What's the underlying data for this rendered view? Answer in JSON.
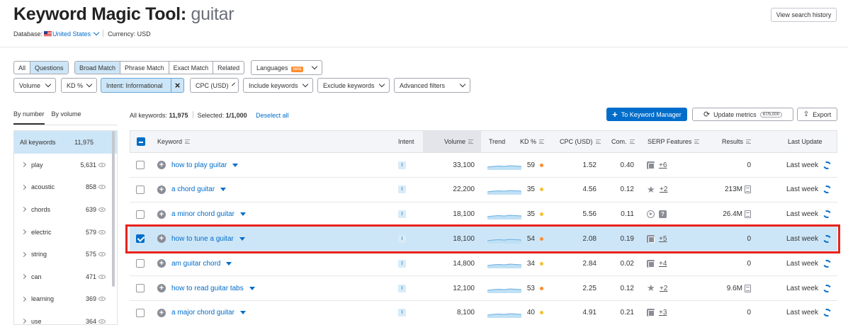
{
  "header": {
    "title": "Keyword Magic Tool:",
    "keyword": "guitar",
    "database_label": "Database:",
    "database_value": "United States",
    "currency_label": "Currency: USD",
    "history_button": "View search history"
  },
  "filters": {
    "type_tabs": [
      "All",
      "Questions"
    ],
    "match_tabs": [
      "Broad Match",
      "Phrase Match",
      "Exact Match",
      "Related"
    ],
    "languages_label": "Languages",
    "beta_badge": "beta",
    "dropdowns": [
      "Volume",
      "KD %",
      "Intent: Informational",
      "CPC (USD)",
      "Include keywords",
      "Exclude keywords",
      "Advanced filters"
    ],
    "remove_intent": "×"
  },
  "sidebar": {
    "sort_tabs": [
      "By number",
      "By volume"
    ],
    "all_label": "All keywords",
    "all_count": "11,975",
    "items": [
      {
        "label": "play",
        "count": "5,631"
      },
      {
        "label": "acoustic",
        "count": "858"
      },
      {
        "label": "chords",
        "count": "639"
      },
      {
        "label": "electric",
        "count": "579"
      },
      {
        "label": "string",
        "count": "575"
      },
      {
        "label": "can",
        "count": "471"
      },
      {
        "label": "learning",
        "count": "369"
      },
      {
        "label": "use",
        "count": "364"
      }
    ]
  },
  "summary": {
    "all_keywords_label": "All keywords:",
    "all_keywords_value": "11,975",
    "selected_label": "Selected:",
    "selected_value": "1/1,000",
    "deselect": "Deselect all"
  },
  "actions": {
    "to_keyword_manager": "To Keyword Manager",
    "update_metrics": "Update metrics",
    "quota": "67/5,000",
    "export": "Export"
  },
  "table": {
    "columns": [
      "Keyword",
      "Intent",
      "Volume",
      "Trend",
      "KD %",
      "CPC (USD)",
      "Com.",
      "SERP Features",
      "Results",
      "Last Update"
    ],
    "rows": [
      {
        "keyword": "how to play guitar",
        "intent": "I",
        "volume": "33,100",
        "kd": "59",
        "kd_color": "#ff8c2e",
        "cpc": "1.52",
        "com": "0.40",
        "serp": [
          "doc"
        ],
        "serp_more": "+6",
        "results": "0",
        "results_icon": false,
        "update": "Last week",
        "checked": false
      },
      {
        "keyword": "a chord guitar",
        "intent": "I",
        "volume": "22,200",
        "kd": "35",
        "kd_color": "#f2c230",
        "cpc": "4.56",
        "com": "0.12",
        "serp": [
          "star"
        ],
        "serp_more": "+2",
        "results": "213M",
        "results_icon": true,
        "update": "Last week",
        "checked": false
      },
      {
        "keyword": "a minor chord guitar",
        "intent": "I",
        "volume": "18,100",
        "kd": "35",
        "kd_color": "#f2c230",
        "cpc": "5.56",
        "com": "0.11",
        "serp": [
          "video",
          "q"
        ],
        "serp_more": "",
        "results": "26.4M",
        "results_icon": true,
        "update": "Last week",
        "checked": false
      },
      {
        "keyword": "how to tune a guitar",
        "intent": "I",
        "volume": "18,100",
        "kd": "54",
        "kd_color": "#ff8c2e",
        "cpc": "2.08",
        "com": "0.19",
        "serp": [
          "doc"
        ],
        "serp_more": "+5",
        "results": "0",
        "results_icon": false,
        "update": "Last week",
        "checked": true
      },
      {
        "keyword": "am guitar chord",
        "intent": "I",
        "volume": "14,800",
        "kd": "34",
        "kd_color": "#f2c230",
        "cpc": "2.84",
        "com": "0.02",
        "serp": [
          "doc"
        ],
        "serp_more": "+4",
        "results": "0",
        "results_icon": false,
        "update": "Last week",
        "checked": false
      },
      {
        "keyword": "how to read guitar tabs",
        "intent": "I",
        "volume": "12,100",
        "kd": "53",
        "kd_color": "#ff8c2e",
        "cpc": "2.25",
        "com": "0.12",
        "serp": [
          "star"
        ],
        "serp_more": "+2",
        "results": "9.6M",
        "results_icon": true,
        "update": "Last week",
        "checked": false
      },
      {
        "keyword": "a major chord guitar",
        "intent": "I",
        "volume": "8,100",
        "kd": "40",
        "kd_color": "#f2c230",
        "cpc": "4.91",
        "com": "0.21",
        "serp": [
          "doc"
        ],
        "serp_more": "+3",
        "results": "0",
        "results_icon": false,
        "update": "Last week",
        "checked": false
      }
    ]
  }
}
